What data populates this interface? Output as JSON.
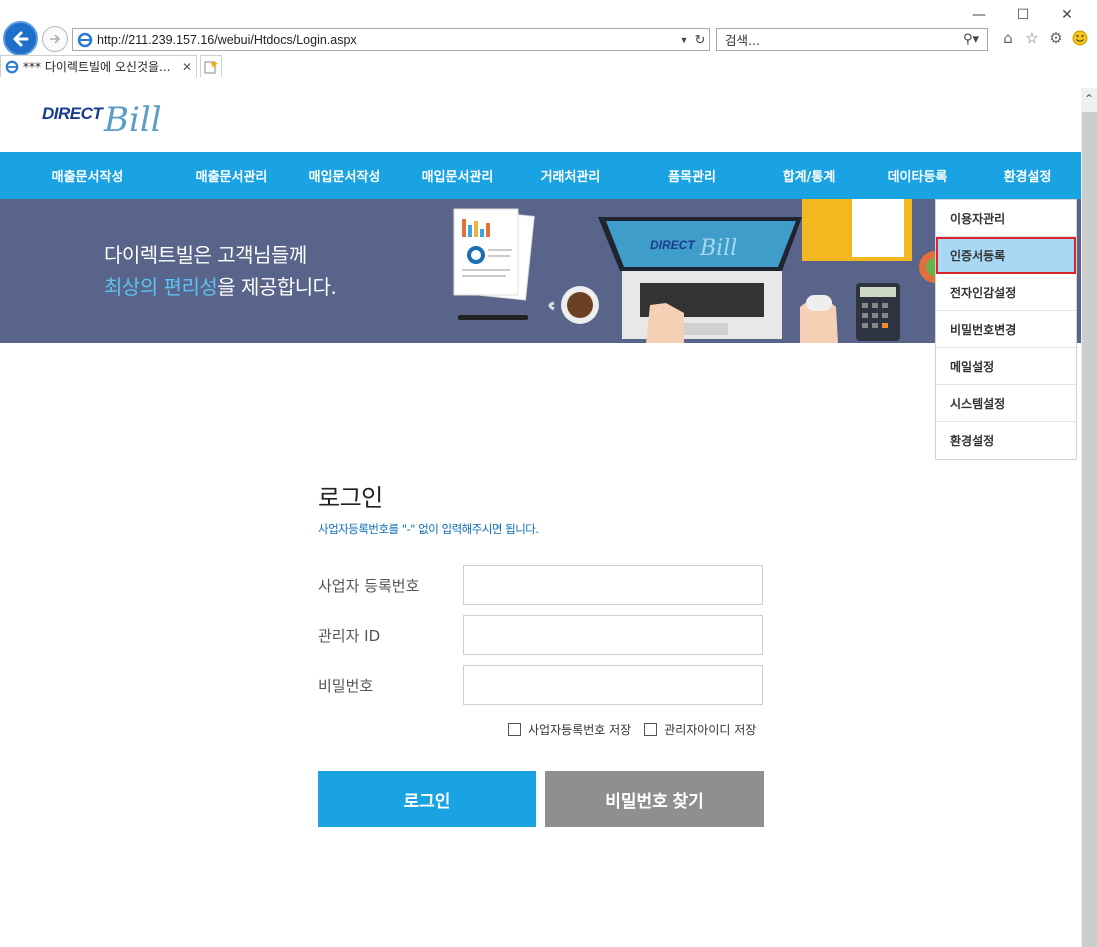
{
  "browser": {
    "url": "http://211.239.157.16/webui/Htdocs/Login.aspx",
    "search_placeholder": "검색...",
    "tab_title": "*** 다이렉트빌에 오신것을..."
  },
  "brand": {
    "direct": "DIRECT",
    "bill": "Bill"
  },
  "nav": {
    "items": [
      "매출문서작성",
      "매출문서관리",
      "매입문서작성",
      "매입문서관리",
      "거래처관리",
      "품목관리",
      "합계/통계",
      "데이타등록",
      "환경설정"
    ]
  },
  "banner": {
    "line1": "다이렉트빌은 고객님들께",
    "line2_highlight": "최상의 편리성",
    "line2_rest": "을 제공합니다.",
    "laptop_brand_direct": "DIRECT",
    "laptop_brand_bill": "Bill"
  },
  "dropdown": {
    "items": [
      "이용자관리",
      "인증서등록",
      "전자인감설정",
      "비밀번호변경",
      "메일설정",
      "시스템설정",
      "환경설정"
    ],
    "active_index": 1
  },
  "login": {
    "title": "로그인",
    "hint": "사업자등록번호를 \"-\" 없이 입력해주시면 됩니다.",
    "fields": {
      "bizno_label": "사업자 등록번호",
      "adminid_label": "관리자 ID",
      "password_label": "비밀번호"
    },
    "save_bizno_label": "사업자등록번호 저장",
    "save_adminid_label": "관리자아이디 저장",
    "login_button": "로그인",
    "find_password_button": "비밀번호 찾기"
  },
  "colors": {
    "nav_bg": "#1aa3e3",
    "banner_bg": "#58648a",
    "highlight_text": "#5ec3f2",
    "hint_text": "#0a6fb5",
    "active_menu_bg": "#a8d8f4",
    "active_menu_border": "#d9232d",
    "secondary_button": "#8f8f8f"
  }
}
